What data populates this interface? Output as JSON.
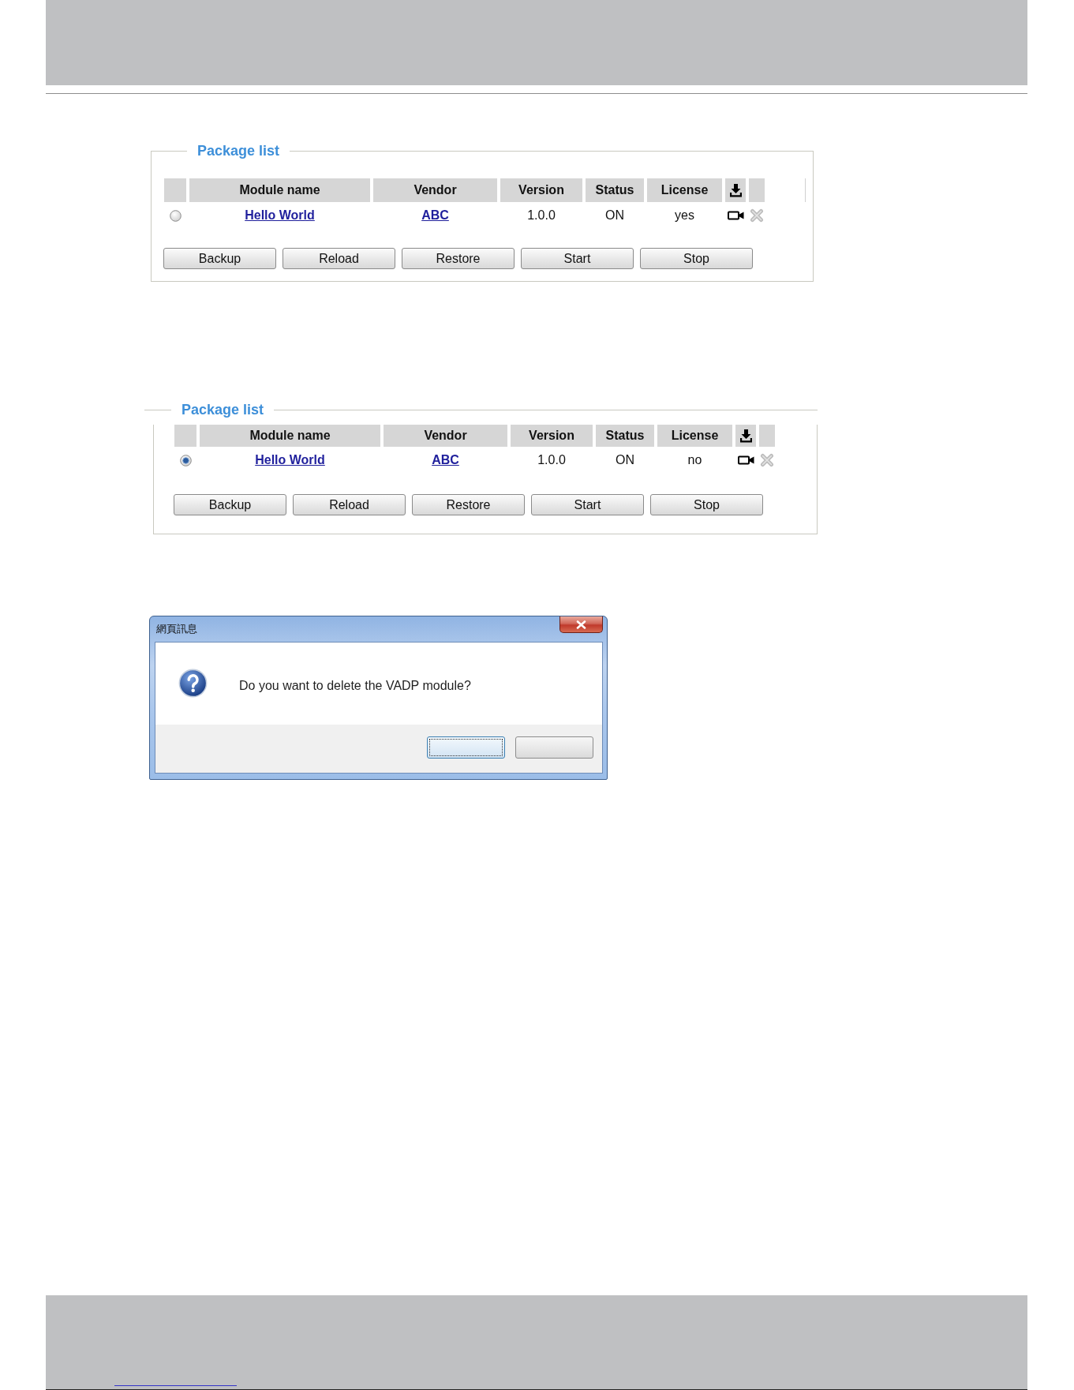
{
  "package_lists": [
    {
      "legend": "Package list",
      "columns": [
        "Module name",
        "Vendor",
        "Version",
        "Status",
        "License"
      ],
      "rows": [
        {
          "selected": false,
          "module_name": "Hello World",
          "vendor": "ABC",
          "version": "1.0.0",
          "status": "ON",
          "license": "yes"
        }
      ],
      "buttons": [
        "Backup",
        "Reload",
        "Restore",
        "Start",
        "Stop"
      ]
    },
    {
      "legend": "Package list",
      "columns": [
        "Module name",
        "Vendor",
        "Version",
        "Status",
        "License"
      ],
      "rows": [
        {
          "selected": true,
          "module_name": "Hello World",
          "vendor": "ABC",
          "version": "1.0.0",
          "status": "ON",
          "license": "no"
        }
      ],
      "buttons": [
        "Backup",
        "Reload",
        "Restore",
        "Start",
        "Stop"
      ]
    }
  ],
  "dialog": {
    "title": "網頁訊息",
    "message": "Do you want to delete the VADP module?",
    "buttons": [
      {
        "default": true
      },
      {
        "default": false
      }
    ]
  }
}
